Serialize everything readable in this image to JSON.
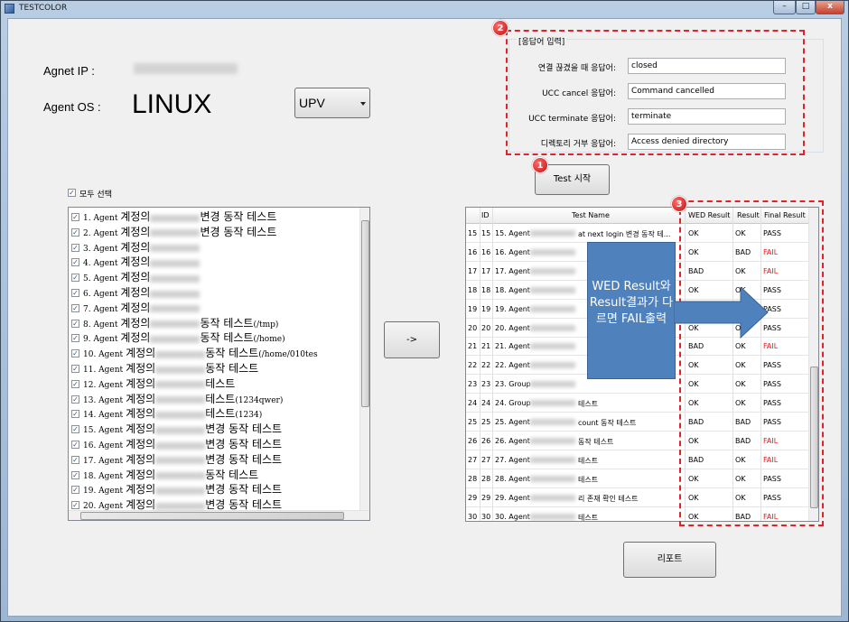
{
  "window": {
    "title": "TESTCOLOR",
    "controls": [
      "–",
      "□",
      "x"
    ]
  },
  "agent": {
    "ip_label": "Agnet IP  :",
    "os_label": "Agent OS  :",
    "os_value": "LINUX",
    "os_combo": "UPV"
  },
  "response_group": {
    "title": "[응답어 입력]",
    "rows": [
      {
        "label": "연결 끊겼을 때 응답어:",
        "value": "closed"
      },
      {
        "label": "UCC cancel 응답어:",
        "value": "Command cancelled"
      },
      {
        "label": "UCC terminate 응답어:",
        "value": "terminate"
      },
      {
        "label": "디렉토리 거부 응답어:",
        "value": "Access denied directory"
      }
    ]
  },
  "buttons": {
    "test_start": "Test 시작",
    "move": "->",
    "report": "리포트"
  },
  "select_all": "모두 선택",
  "badges": [
    "1",
    "2",
    "3"
  ],
  "callout": "WED Result와 Result결과가 다르면 FAIL출력",
  "test_list": [
    {
      "num": "1. Agent",
      "ko": "계정의",
      "suffix": "변경 동작 테스트",
      "tail": ""
    },
    {
      "num": "2. Agent",
      "ko": "계정의",
      "suffix": "변경 동작 테스트",
      "tail": ""
    },
    {
      "num": "3. Agent",
      "ko": "계정의",
      "suffix": "",
      "tail": ""
    },
    {
      "num": "4. Agent",
      "ko": "계정의",
      "suffix": "",
      "tail": ""
    },
    {
      "num": "5. Agent",
      "ko": "계정의",
      "suffix": "",
      "tail": ""
    },
    {
      "num": "6. Agent",
      "ko": "계정의",
      "suffix": "",
      "tail": ""
    },
    {
      "num": "7. Agent",
      "ko": "계정의",
      "suffix": "",
      "tail": ""
    },
    {
      "num": "8. Agent",
      "ko": "계정의",
      "suffix": "동작 테스트",
      "tail": "(/tmp)"
    },
    {
      "num": "9. Agent",
      "ko": "계정의",
      "suffix": "동작 테스트",
      "tail": "(/home)"
    },
    {
      "num": "10. Agent",
      "ko": "계정의",
      "suffix": "동작 테스트",
      "tail": "(/home/010tes"
    },
    {
      "num": "11. Agent",
      "ko": "계정의",
      "suffix": "동작 테스트",
      "tail": ""
    },
    {
      "num": "12. Agent",
      "ko": "계정의",
      "suffix": "테스트",
      "tail": ""
    },
    {
      "num": "13. Agent",
      "ko": "계정의",
      "suffix": "테스트",
      "tail": "(1234qwer)"
    },
    {
      "num": "14. Agent",
      "ko": "계정의",
      "suffix": "테스트",
      "tail": "(1234)"
    },
    {
      "num": "15. Agent",
      "ko": "계정의",
      "suffix": "변경 동작 테스트",
      "tail": ""
    },
    {
      "num": "16. Agent",
      "ko": "계정의",
      "suffix": "변경 동작 테스트",
      "tail": ""
    },
    {
      "num": "17. Agent",
      "ko": "계정의",
      "suffix": "변경 동작 테스트",
      "tail": ""
    },
    {
      "num": "18. Agent",
      "ko": "계정의",
      "suffix": "동작 테스트",
      "tail": ""
    },
    {
      "num": "19. Agent",
      "ko": "계정의",
      "suffix": "변경 동작 테스트",
      "tail": ""
    },
    {
      "num": "20. Agent",
      "ko": "계정의",
      "suffix": "변경 동작 테스트",
      "tail": ""
    }
  ],
  "grid": {
    "headers": [
      "ID",
      "Test Name",
      "WED Result",
      "Result",
      "Final Result"
    ],
    "rows": [
      {
        "rn": "15",
        "id": "15",
        "name": "15. Agent",
        "tail": "at next login 변경 동작 테...",
        "wed": "OK",
        "res": "OK",
        "final": "PASS"
      },
      {
        "rn": "16",
        "id": "16",
        "name": "16. Agent",
        "tail": "",
        "wed": "OK",
        "res": "BAD",
        "final": "FAIL"
      },
      {
        "rn": "17",
        "id": "17",
        "name": "17. Agent",
        "tail": "",
        "wed": "BAD",
        "res": "OK",
        "final": "FAIL"
      },
      {
        "rn": "18",
        "id": "18",
        "name": "18. Agent",
        "tail": "",
        "wed": "OK",
        "res": "OK",
        "final": "PASS"
      },
      {
        "rn": "19",
        "id": "19",
        "name": "19. Agent",
        "tail": "",
        "wed": "",
        "res": "",
        "final": "PASS"
      },
      {
        "rn": "20",
        "id": "20",
        "name": "20. Agent",
        "tail": "",
        "wed": "OK",
        "res": "OK",
        "final": "PASS"
      },
      {
        "rn": "21",
        "id": "21",
        "name": "21. Agent",
        "tail": "",
        "wed": "BAD",
        "res": "OK",
        "final": "FAIL"
      },
      {
        "rn": "22",
        "id": "22",
        "name": "22. Agent",
        "tail": "",
        "wed": "OK",
        "res": "OK",
        "final": "PASS"
      },
      {
        "rn": "23",
        "id": "23",
        "name": "23. Group",
        "tail": "",
        "wed": "OK",
        "res": "OK",
        "final": "PASS"
      },
      {
        "rn": "24",
        "id": "24",
        "name": "24. Group",
        "tail": "테스트",
        "wed": "OK",
        "res": "OK",
        "final": "PASS"
      },
      {
        "rn": "25",
        "id": "25",
        "name": "25. Agent",
        "tail": "count 동작 테스트",
        "wed": "BAD",
        "res": "BAD",
        "final": "PASS"
      },
      {
        "rn": "26",
        "id": "26",
        "name": "26. Agent",
        "tail": "동작 테스트",
        "wed": "OK",
        "res": "BAD",
        "final": "FAIL"
      },
      {
        "rn": "27",
        "id": "27",
        "name": "27. Agent",
        "tail": "테스트",
        "wed": "BAD",
        "res": "OK",
        "final": "FAIL"
      },
      {
        "rn": "28",
        "id": "28",
        "name": "28. Agent",
        "tail": "테스트",
        "wed": "OK",
        "res": "OK",
        "final": "PASS"
      },
      {
        "rn": "29",
        "id": "29",
        "name": "29. Agent",
        "tail": "리 존재 확인 테스트",
        "wed": "OK",
        "res": "OK",
        "final": "PASS"
      },
      {
        "rn": "30",
        "id": "30",
        "name": "30. Agent",
        "tail": "테스트",
        "wed": "OK",
        "res": "BAD",
        "final": "FAIL"
      }
    ]
  }
}
